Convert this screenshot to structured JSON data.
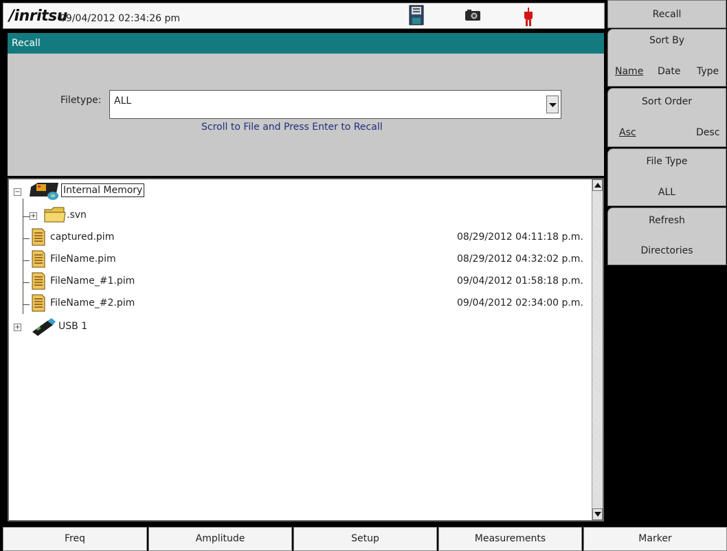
{
  "status_bar": {
    "brand": "/inritsu",
    "datetime": "09/04/2012 02:34:26 pm",
    "icons": [
      "save-icon",
      "camera-icon",
      "power-plug-icon"
    ]
  },
  "header": {
    "title": "Recall"
  },
  "options": {
    "filetype_label": "Filetype:",
    "filetype_value": "ALL",
    "hint": "Scroll to File and Press Enter to Recall"
  },
  "tree": {
    "root": "Internal Memory",
    "folder": ".svn",
    "files": [
      {
        "name": "captured.pim",
        "date": "08/29/2012 04:11:18 p.m."
      },
      {
        "name": "FileName.pim",
        "date": "08/29/2012 04:32:02 p.m."
      },
      {
        "name": "FileName_#1.pim",
        "date": "09/04/2012 01:58:18 p.m."
      },
      {
        "name": "FileName_#2.pim",
        "date": "09/04/2012 02:34:00 p.m."
      }
    ],
    "usb": "USB 1"
  },
  "softkeys": {
    "title": "Recall",
    "sort_by": {
      "label": "Sort By",
      "options": [
        "Name",
        "Date",
        "Type"
      ],
      "selected": "Name"
    },
    "sort_order": {
      "label": "Sort Order",
      "options": [
        "Asc",
        "Desc"
      ],
      "selected": "Asc"
    },
    "file_type": {
      "label": "File Type",
      "value": "ALL"
    },
    "refresh": {
      "label": "Refresh",
      "sub": "Directories"
    }
  },
  "bottom_menu": [
    "Freq",
    "Amplitude",
    "Setup",
    "Measurements",
    "Marker"
  ],
  "colors": {
    "header_teal": "#137b7f",
    "hint_blue": "#1f2e7a",
    "panel_gray": "#c8c8c8"
  }
}
